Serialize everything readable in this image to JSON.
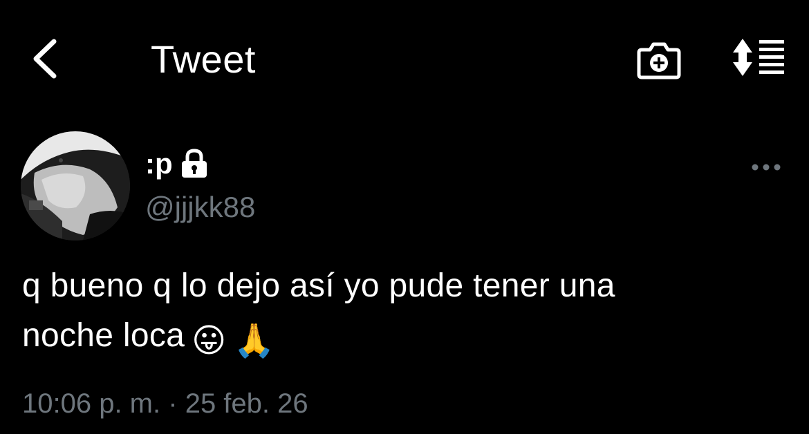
{
  "header": {
    "title": "Tweet"
  },
  "author": {
    "display_name": ":p",
    "handle": "@jjjkk88",
    "protected": true
  },
  "tweet": {
    "line1": "q bueno q lo dejo así yo pude tener una",
    "line2": "noche loca",
    "emojis": [
      "😛",
      "🙏"
    ]
  },
  "meta": {
    "time": "10:06 p. m.",
    "separator": "·",
    "date": "25 feb. 26"
  },
  "icons": {
    "back": "chevron-left-icon",
    "camera": "camera-plus-icon",
    "sort": "sort-list-icon",
    "lock": "lock-icon",
    "more": "more-horizontal-icon"
  },
  "colors": {
    "background": "#000000",
    "text_primary": "#ffffff",
    "text_secondary": "#6e767d"
  }
}
